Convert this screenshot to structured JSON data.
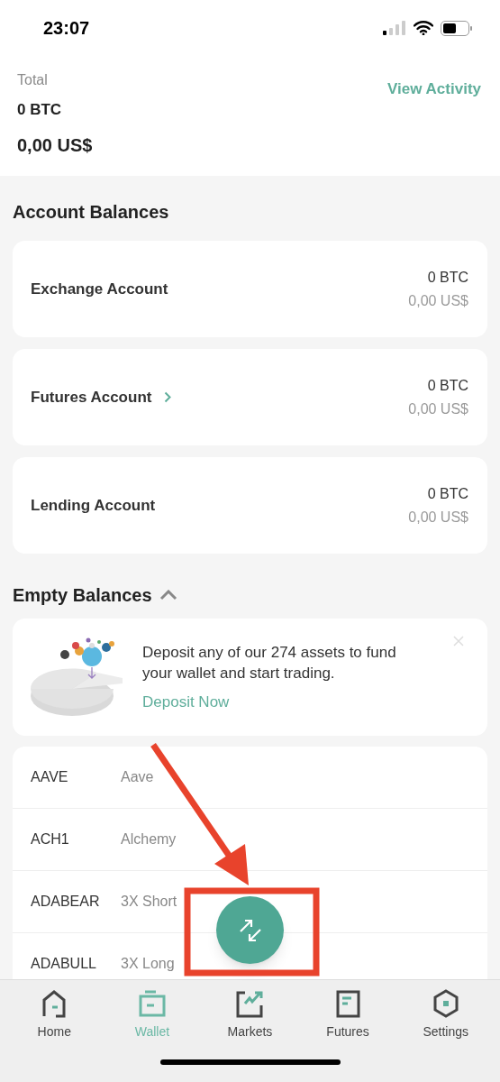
{
  "status_bar": {
    "time": "23:07"
  },
  "total": {
    "label": "Total",
    "btc": "0 BTC",
    "fiat": "0,00 US$",
    "link": "View Activity"
  },
  "account_balances": {
    "title": "Account Balances",
    "accounts": [
      {
        "name": "Exchange Account",
        "kind": "plain",
        "btc": "0 BTC",
        "fiat": "0,00 US$"
      },
      {
        "name": "Futures Account",
        "kind": "link",
        "btc": "0 BTC",
        "fiat": "0,00 US$"
      },
      {
        "name": "Lending Account",
        "kind": "plain",
        "btc": "0 BTC",
        "fiat": "0,00 US$"
      }
    ]
  },
  "empty_balances": {
    "title": "Empty Balances",
    "expanded": true,
    "promo": {
      "text": "Deposit any of our 274 assets to fund your wallet and start trading.",
      "link": "Deposit Now"
    },
    "assets": [
      {
        "symbol": "AAVE",
        "name": "Aave"
      },
      {
        "symbol": "ACH1",
        "name": "Alchemy"
      },
      {
        "symbol": "ADABEAR",
        "name": "3X Short"
      },
      {
        "symbol": "ADABULL",
        "name": "3X Long"
      }
    ]
  },
  "tab_bar": [
    {
      "label": "Home",
      "selected": false
    },
    {
      "label": "Wallet",
      "selected": true
    },
    {
      "label": "Markets",
      "selected": false
    },
    {
      "label": "Futures",
      "selected": false
    },
    {
      "label": "Settings",
      "selected": false
    }
  ]
}
